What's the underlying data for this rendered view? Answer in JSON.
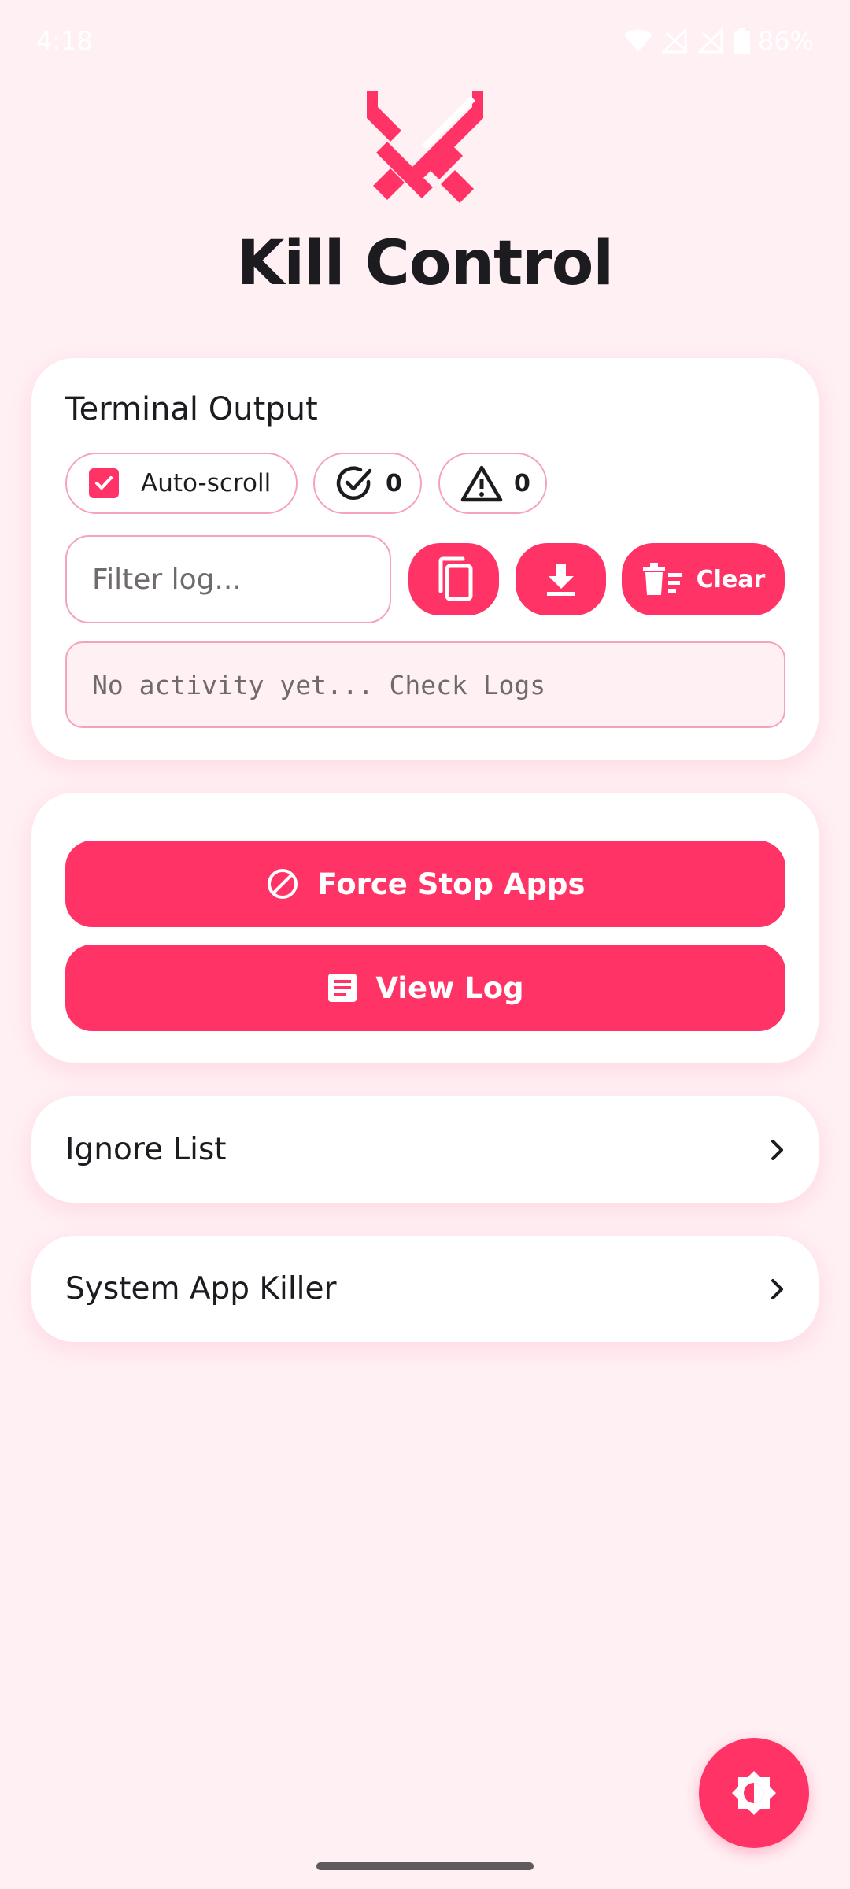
{
  "status_bar": {
    "time": "4:18",
    "battery": "86%"
  },
  "app": {
    "title": "Kill Control"
  },
  "terminal": {
    "title": "Terminal Output",
    "autoscroll_label": "Auto-scroll",
    "success_count": "0",
    "warning_count": "0",
    "filter_placeholder": "Filter log...",
    "clear_label": "Clear",
    "log_text": "No activity yet... Check Logs"
  },
  "actions": {
    "force_stop_label": "Force Stop Apps",
    "view_log_label": "View Log"
  },
  "nav": {
    "ignore_list_label": "Ignore List",
    "system_app_killer_label": "System App Killer"
  },
  "colors": {
    "accent": "#ff3366",
    "background": "#fff0f4",
    "outline": "#f4a3bb"
  }
}
